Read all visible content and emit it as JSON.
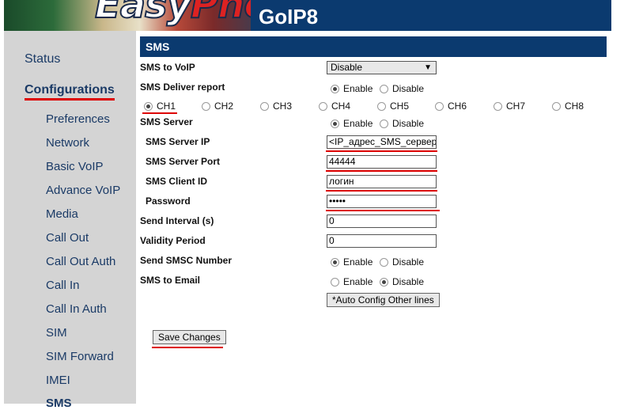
{
  "header": {
    "logo_text_a": "Easy",
    "logo_text_b": "Pho",
    "title": "GoIP8"
  },
  "sidebar": {
    "status": "Status",
    "configurations": "Configurations",
    "items": [
      "Preferences",
      "Network",
      "Basic VoIP",
      "Advance VoIP",
      "Media",
      "Call Out",
      "Call Out Auth",
      "Call In",
      "Call In Auth",
      "SIM",
      "SIM Forward",
      "IMEI",
      "SMS"
    ]
  },
  "section": {
    "title": "SMS"
  },
  "form": {
    "sms_to_voip": {
      "label": "SMS to VoIP",
      "value": "Disable"
    },
    "deliver_report": {
      "label": "SMS Deliver report",
      "enable": "Enable",
      "disable": "Disable"
    },
    "channels": [
      "CH1",
      "CH2",
      "CH3",
      "CH4",
      "CH5",
      "CH6",
      "CH7",
      "CH8"
    ],
    "sms_server": {
      "label": "SMS Server",
      "enable": "Enable",
      "disable": "Disable"
    },
    "server_ip": {
      "label": "SMS Server IP",
      "value": "<IP_адрес_SMS_сервера"
    },
    "server_port": {
      "label": "SMS Server Port",
      "value": "44444"
    },
    "client_id": {
      "label": "SMS Client ID",
      "value": "логин"
    },
    "password": {
      "label": "Password",
      "value": "•••••"
    },
    "send_interval": {
      "label": "Send Interval (s)",
      "value": "0"
    },
    "validity": {
      "label": "Validity Period",
      "value": "0"
    },
    "smsc": {
      "label": "Send SMSC Number",
      "enable": "Enable",
      "disable": "Disable"
    },
    "sms_email": {
      "label": "SMS to Email",
      "enable": "Enable",
      "disable": "Disable"
    },
    "auto_config": "*Auto Config Other lines",
    "save": "Save Changes"
  },
  "colors": {
    "header": "#0b3a6f",
    "sidebar": "#d4d4d4",
    "nav_text": "#1a3a66",
    "annotation": "#dd0000"
  }
}
